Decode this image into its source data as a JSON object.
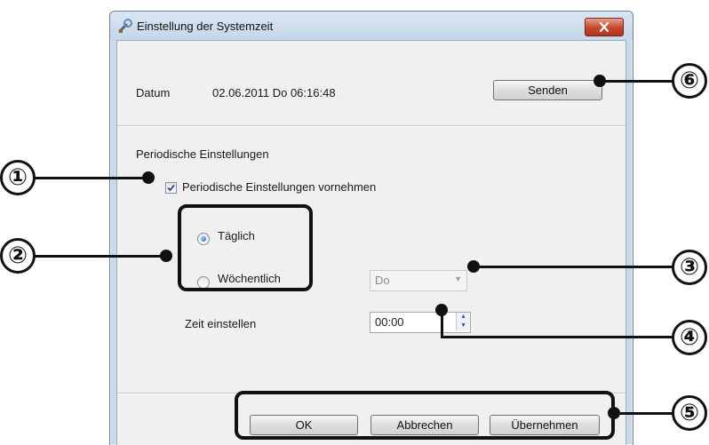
{
  "window": {
    "title": "Einstellung der Systemzeit"
  },
  "date_row": {
    "label": "Datum",
    "value": "02.06.2011 Do 06:16:48",
    "send_label": "Senden"
  },
  "periodic": {
    "section_label": "Periodische Einstellungen",
    "checkbox_label": "Periodische Einstellungen vornehmen",
    "checkbox_checked": true,
    "radio_daily_label": "Täglich",
    "radio_weekly_label": "Wöchentlich",
    "selected": "daily",
    "weekday_value": "Do",
    "time_label": "Zeit einstellen",
    "time_value": "00:00"
  },
  "buttons": {
    "ok": "OK",
    "cancel": "Abbrechen",
    "apply": "Übernehmen"
  },
  "callouts": [
    "①",
    "②",
    "③",
    "④",
    "⑤",
    "⑥"
  ],
  "colors": {
    "close_red": "#c6452c",
    "radio_blue": "#1a5fb4",
    "title_bar": "#c9d9ea"
  }
}
